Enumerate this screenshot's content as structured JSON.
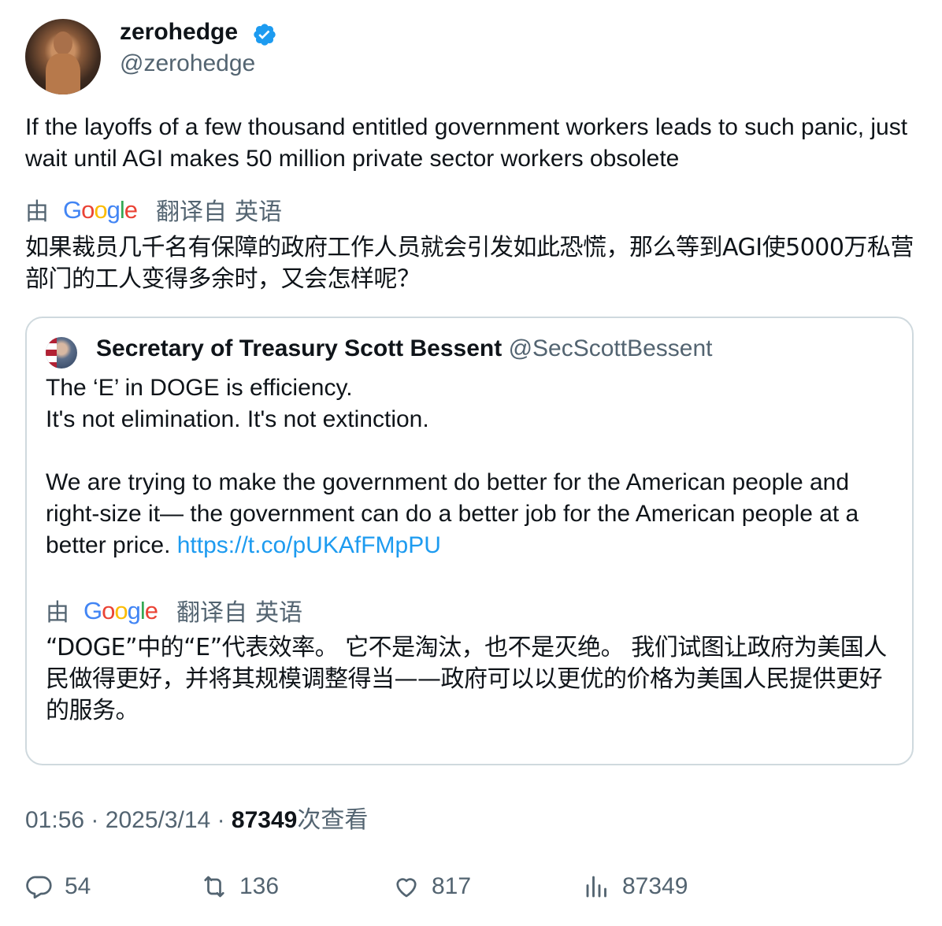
{
  "author": {
    "name": "zerohedge",
    "handle": "@zerohedge"
  },
  "tweet_text": "If the layoffs of a few thousand entitled government workers leads to such panic, just wait until AGI makes 50 million private sector workers obsolete",
  "translation_bar": {
    "by": "由",
    "brand": "Google",
    "translated_from": "翻译自",
    "language": "英语"
  },
  "tweet_translation": "如果裁员几千名有保障的政府工作人员就会引发如此恐慌，那么等到AGI使5000万私营部门的工人变得多余时，又会怎样呢？",
  "quoted": {
    "name": "Secretary of Treasury Scott Bessent",
    "handle": "@SecScottBessent",
    "text": "The ‘E’ in DOGE is efficiency.\nIt's not elimination. It's not extinction.\n\nWe are trying to make the government do better for the American people and right-size it— the government can do a better job for the American people at a better price. ",
    "link": "https://t.co/pUKAfFMpPU",
    "translation": "“DOGE”中的“E”代表效率。 它不是淘汰，也不是灭绝。 我们试图让政府为美国人民做得更好，并将其规模调整得当——政府可以以更优的价格为美国人民提供更好的服务。"
  },
  "meta": {
    "time": "01:56",
    "separator": "·",
    "date": "2025/3/14",
    "views": "87349",
    "views_label": "次查看"
  },
  "actions": {
    "replies": "54",
    "retweets": "136",
    "likes": "817",
    "views": "87349"
  },
  "colors": {
    "link": "#1d9bf0",
    "secondary_text": "#536471",
    "verified": "#1d9bf0",
    "border": "#cfd9de"
  },
  "icons": [
    "verified-badge-icon",
    "google-logo",
    "reply-icon",
    "retweet-icon",
    "like-icon",
    "views-icon"
  ]
}
